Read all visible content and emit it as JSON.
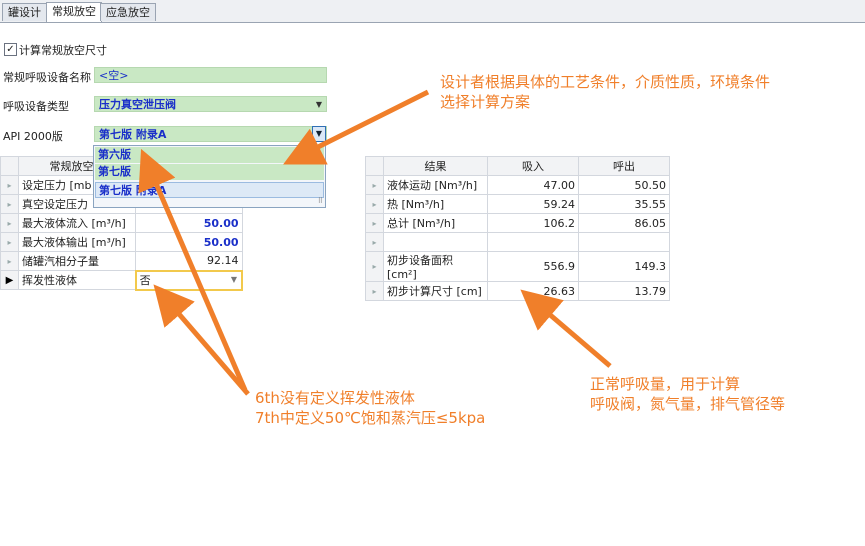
{
  "tabs": [
    "罐设计",
    "常规放空",
    "应急放空"
  ],
  "active_tab": 1,
  "checkbox": {
    "checked": true,
    "label": "计算常规放空尺寸",
    "mark": "✓"
  },
  "form": {
    "name_label": "常规呼吸设备名称",
    "name_value": "<空>",
    "type_label": "呼吸设备类型",
    "type_value": "压力真空泄压阀",
    "api_label": "API 2000版",
    "api_value": "第七版 附录A",
    "dropdown_arrow": "▼"
  },
  "api_options": [
    "第六版",
    "第七版",
    "第七版 附录A"
  ],
  "left_grid": {
    "header": "常规放空尺",
    "rows": [
      {
        "label": "设定压力 [mb",
        "value": ""
      },
      {
        "label": "真空设定压力",
        "value": ""
      },
      {
        "label": "最大液体流入 [m³/h]",
        "value": "50.00"
      },
      {
        "label": "最大液体输出 [m³/h]",
        "value": "50.00"
      },
      {
        "label": "储罐汽相分子量",
        "value": "92.14"
      },
      {
        "label": "挥发性液体",
        "value": "否"
      }
    ],
    "current_row_marker": "▶"
  },
  "results_grid": {
    "headers": [
      "结果",
      "吸入",
      "呼出"
    ],
    "rows": [
      {
        "label": "液体运动 [Nm³/h]",
        "in": "47.00",
        "out": "50.50"
      },
      {
        "label": "热 [Nm³/h]",
        "in": "59.24",
        "out": "35.55"
      },
      {
        "label": "总计 [Nm³/h]",
        "in": "106.2",
        "out": "86.05"
      },
      {
        "label": "",
        "in": "",
        "out": ""
      },
      {
        "label": "初步设备面积 [cm²]",
        "in": "556.9",
        "out": "149.3"
      },
      {
        "label": "初步计算尺寸 [cm]",
        "in": "26.63",
        "out": "13.79"
      }
    ]
  },
  "annotations": {
    "top_right": [
      "设计者根据具体的工艺条件，介质性质，环境条件",
      "选择计算方案"
    ],
    "bottom_left": [
      "6th没有定义挥发性液体",
      "7th中定义50℃饱和蒸汽压≤5kpa"
    ],
    "bottom_right": [
      "正常呼吸量，用于计算",
      "呼吸阀，氮气量，排气管径等"
    ]
  },
  "colors": {
    "annotation": "#f07f2a",
    "field_green": "#c9e8c4",
    "value_blue": "#1a2fc9"
  }
}
